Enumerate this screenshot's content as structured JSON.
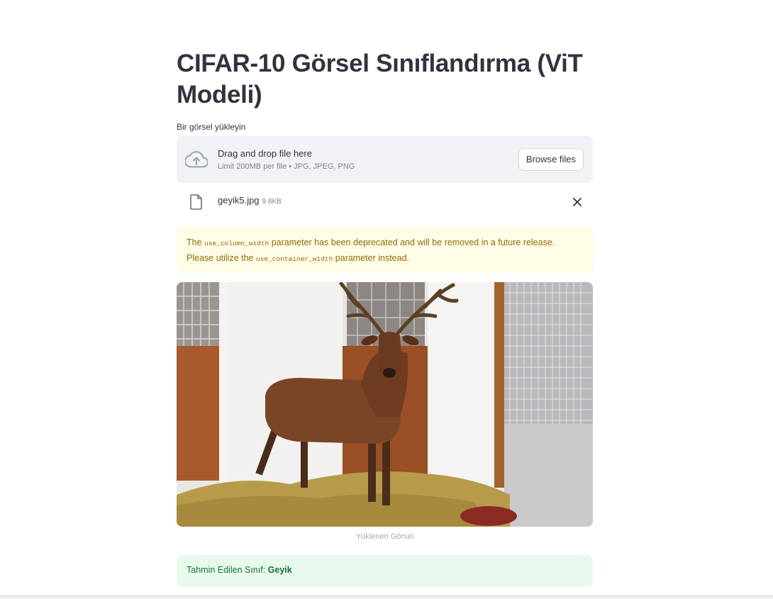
{
  "page": {
    "title": "CIFAR-10 Görsel Sınıflandırma (ViT Modeli)"
  },
  "uploader": {
    "label": "Bir görsel yükleyin",
    "drag_text": "Drag and drop file here",
    "limit_text": "Limit 200MB per file • JPG, JPEG, PNG",
    "browse_label": "Browse files",
    "upload_icon": "cloud-upload-icon"
  },
  "file": {
    "name": "geyik5.jpg",
    "size": "9.8KB",
    "icon": "file-icon",
    "remove_icon": "close-icon"
  },
  "warning": {
    "text_1": "The ",
    "code_1": "use_column_width",
    "text_2": " parameter has been deprecated and will be removed in a future release. Please utilize the ",
    "code_2": "use_container_width",
    "text_3": " parameter instead."
  },
  "image": {
    "caption": "Yüklenen Görsel"
  },
  "result": {
    "prefix": "Tahmin Edilen Sınıf: ",
    "class_name": "Geyik"
  },
  "colors": {
    "warning_bg": "#fffce7",
    "warning_text": "#926c05",
    "success_bg": "#e8f9ee",
    "success_text": "#177233",
    "dropzone_bg": "#f0f2f6"
  }
}
